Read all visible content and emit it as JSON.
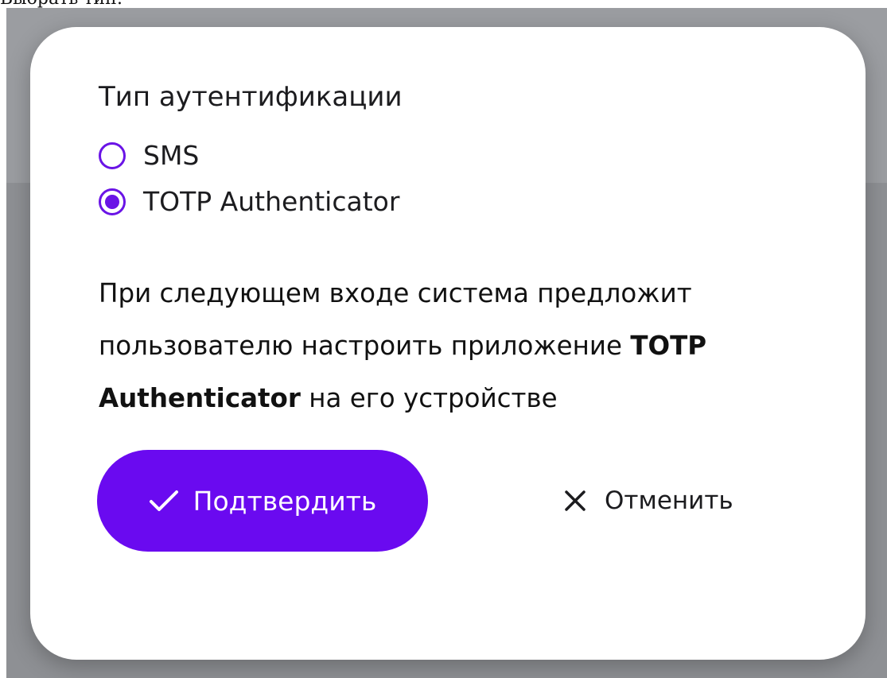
{
  "caption": "Выбрать тип:",
  "dialog": {
    "heading": "Тип аутентификации",
    "options": [
      {
        "label": "SMS",
        "selected": false
      },
      {
        "label": "TOTP Authenticator",
        "selected": true
      }
    ],
    "description": {
      "part1": "При следующем входе система предложит пользователю настроить приложение ",
      "bold": "TOTP Authenticator",
      "part2": " на его устройстве"
    },
    "confirm_label": "Подтвердить",
    "cancel_label": "Отменить",
    "accent_color": "#6a0af0",
    "icons": {
      "confirm": "check-icon",
      "cancel": "close-icon"
    }
  }
}
